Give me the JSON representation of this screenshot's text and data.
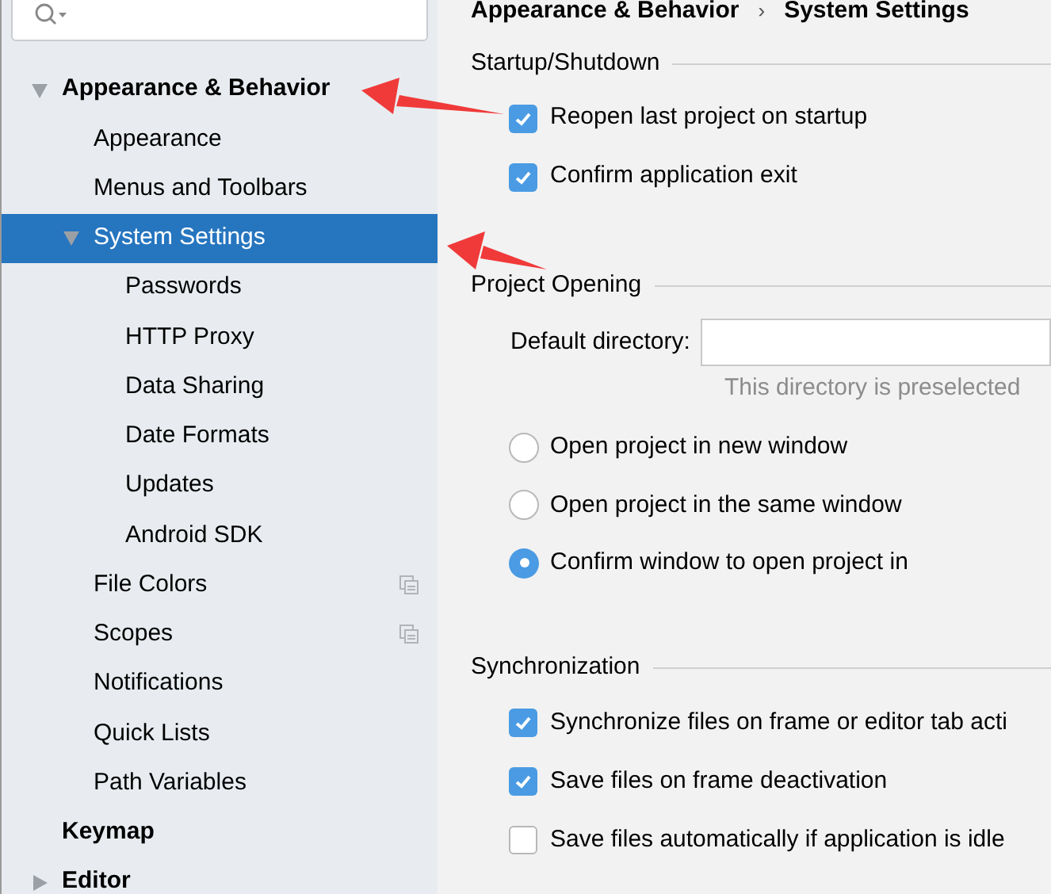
{
  "sidebar": {
    "tree": [
      {
        "label": "Appearance & Behavior",
        "expanded": true,
        "selected": false,
        "children": [
          {
            "label": "Appearance",
            "selected": false
          },
          {
            "label": "Menus and Toolbars",
            "selected": false
          },
          {
            "label": "System Settings",
            "expanded": true,
            "selected": true,
            "children": [
              {
                "label": "Passwords",
                "selected": false
              },
              {
                "label": "HTTP Proxy",
                "selected": false
              },
              {
                "label": "Data Sharing",
                "selected": false
              },
              {
                "label": "Date Formats",
                "selected": false
              },
              {
                "label": "Updates",
                "selected": false
              },
              {
                "label": "Android SDK",
                "selected": false
              }
            ]
          },
          {
            "label": "File Colors",
            "selected": false,
            "project_level": true
          },
          {
            "label": "Scopes",
            "selected": false,
            "project_level": true
          },
          {
            "label": "Notifications",
            "selected": false
          },
          {
            "label": "Quick Lists",
            "selected": false
          },
          {
            "label": "Path Variables",
            "selected": false
          }
        ]
      },
      {
        "label": "Keymap",
        "selected": false
      },
      {
        "label": "Editor",
        "expanded": false,
        "selected": false
      }
    ]
  },
  "breadcrumb": [
    "Appearance & Behavior",
    "System Settings"
  ],
  "breadcrumb_separator": "›",
  "sections": [
    {
      "title": "Startup/Shutdown",
      "items": [
        {
          "kind": "checkbox",
          "label": "Reopen last project on startup",
          "checked": true
        },
        {
          "kind": "checkbox",
          "label": "Confirm application exit",
          "checked": true
        }
      ]
    },
    {
      "title": "Project Opening",
      "items": [
        {
          "kind": "field",
          "label": "Default directory:",
          "value": "",
          "hint": "This directory is preselected"
        },
        {
          "kind": "radio",
          "label": "Open project in new window",
          "selected": false
        },
        {
          "kind": "radio",
          "label": "Open project in the same window",
          "selected": false
        },
        {
          "kind": "radio",
          "label": "Confirm window to open project in",
          "selected": true
        }
      ]
    },
    {
      "title": "Synchronization",
      "items": [
        {
          "kind": "checkbox",
          "label": "Synchronize files on frame or editor tab acti",
          "checked": true
        },
        {
          "kind": "checkbox",
          "label": "Save files on frame deactivation",
          "checked": true
        },
        {
          "kind": "checkbox",
          "label": "Save files automatically if application is idle",
          "checked": false
        }
      ]
    }
  ]
}
